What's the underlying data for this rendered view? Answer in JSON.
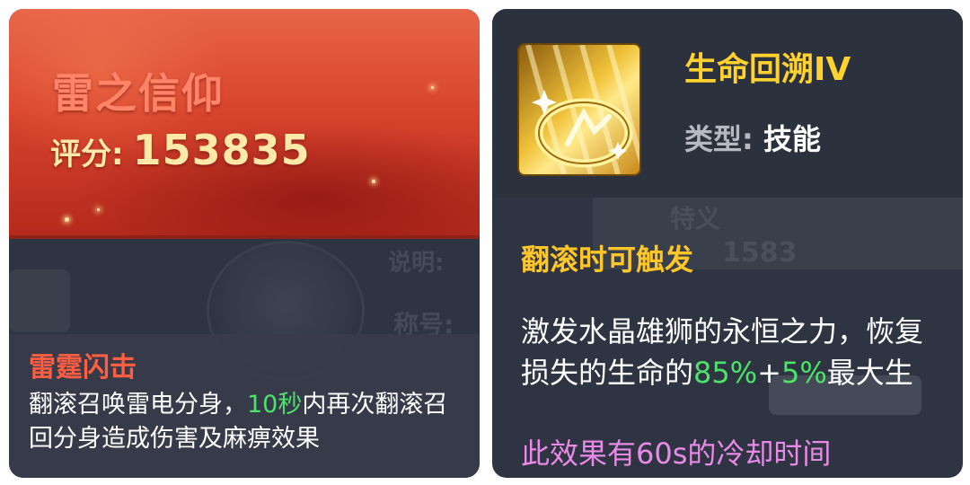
{
  "left_card": {
    "title": "雷之信仰",
    "score_label": "评分:",
    "score_value": "153835",
    "bg_text_1": "说明:",
    "bg_text_2": "称号:",
    "skill": {
      "name": "雷霆闪击",
      "desc_part1": "翻滚召唤雷电分身，",
      "desc_highlight": "10秒",
      "desc_part2": "内再次翻滚召回分身造成伤害及麻痹效果"
    }
  },
  "right_card": {
    "icon": "golden-ring-skill-icon",
    "title": "生命回溯IV",
    "type_label": "类型:",
    "type_value": "技能",
    "bg_text_1": "特义",
    "bg_text_2": "1583",
    "trigger": "翻滚时可触发",
    "effect": {
      "line1": "激发水晶雄狮的永恒之力，恢复",
      "line2_prefix": "损失的生命的",
      "val1": "85%",
      "plus": "+",
      "val2": "5%",
      "line2_suffix": "最大生"
    },
    "cooldown": "此效果有60s的冷却时间"
  },
  "colors": {
    "banner_red": "#d8442d",
    "title_gold": "#ffd230",
    "highlight_green": "#4de36a",
    "cooldown_pink": "#e98ae8",
    "trigger_orange": "#ffc629"
  }
}
